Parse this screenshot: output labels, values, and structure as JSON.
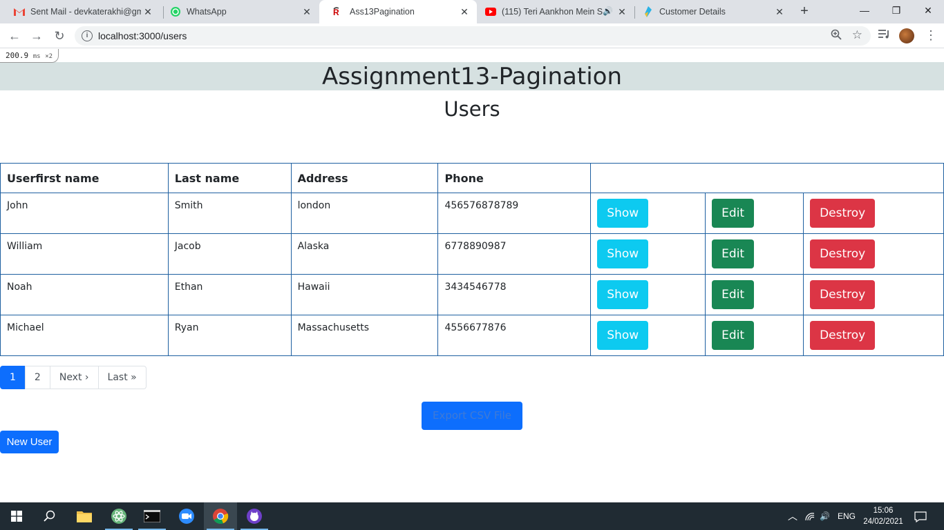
{
  "browser": {
    "tabs": [
      {
        "title": "Sent Mail - devkaterakhi@gma",
        "icon": "gmail-icon"
      },
      {
        "title": "WhatsApp",
        "icon": "whatsapp-icon"
      },
      {
        "title": "Ass13Pagination",
        "icon": "rails-icon",
        "active": true
      },
      {
        "title": "(115) Teri Aankhon Mein S",
        "icon": "youtube-icon"
      },
      {
        "title": "Customer Details",
        "icon": "site-icon"
      }
    ],
    "close_glyph": "✕",
    "new_tab_glyph": "+",
    "url": "localhost:3000/users"
  },
  "perf": {
    "time": "200.9",
    "unit": "ms",
    "count": "×2"
  },
  "page": {
    "app_title": "Assignment13-Pagination",
    "section_title": "Users"
  },
  "table": {
    "headers": [
      "Userfirst name",
      "Last name",
      "Address",
      "Phone"
    ],
    "rows": [
      {
        "first": "John",
        "last": "Smith",
        "address": "london",
        "phone": "456576878789"
      },
      {
        "first": "William",
        "last": "Jacob",
        "address": "Alaska",
        "phone": "6778890987"
      },
      {
        "first": "Noah",
        "last": "Ethan",
        "address": "Hawaii",
        "phone": "3434546778"
      },
      {
        "first": "Michael",
        "last": "Ryan",
        "address": "Massachusetts",
        "phone": "4556677876"
      }
    ],
    "actions": {
      "show": "Show",
      "edit": "Edit",
      "destroy": "Destroy"
    }
  },
  "pagination": {
    "items": [
      "1",
      "2",
      "Next ›",
      "Last »"
    ],
    "current": "1"
  },
  "buttons": {
    "export_csv": "Export CSV File",
    "new_user": "New User"
  },
  "taskbar": {
    "lang": "ENG",
    "time": "15:06",
    "date": "24/02/2021"
  },
  "colors": {
    "primary": "#0d6efd",
    "info": "#0dcaf0",
    "success": "#198754",
    "danger": "#dc3545",
    "header_band": "#d6e1e1"
  }
}
